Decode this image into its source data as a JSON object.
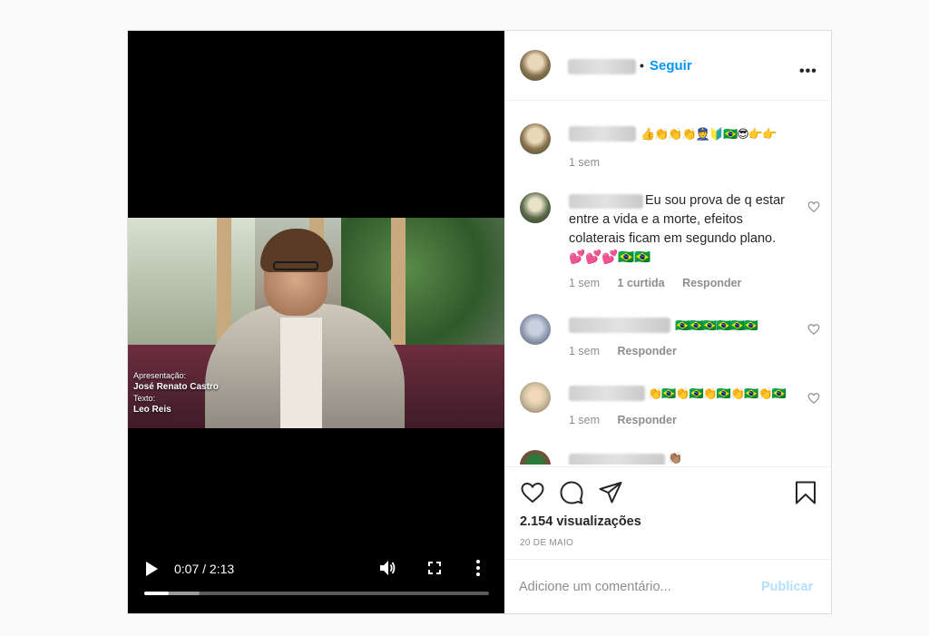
{
  "video": {
    "caption_line1": "Apresentação:",
    "caption_line2": "José Renato Castro",
    "caption_line3": "Texto:",
    "caption_line4": "Leo Reis",
    "time": "0:07 / 2:13",
    "played_fraction": 0.07,
    "buffered_fraction": 0.16,
    "play_icon": "play-icon",
    "volume_icon": "volume-icon",
    "fullscreen_icon": "fullscreen-icon",
    "more_icon": "more-vert-icon"
  },
  "header": {
    "dot": "•",
    "follow_label": "Seguir",
    "more_icon": "more-horizontal-icon"
  },
  "comments": [
    {
      "text": "👍👏👏👏👮🔰🇧🇷😎👉👉",
      "meta": [
        "1 sem"
      ]
    },
    {
      "text": "Eu sou prova de q estar entre a vida e a morte, efeitos colaterais ficam em segundo plano. 💕💕💕🇧🇷🇧🇷",
      "meta": [
        "1 sem",
        "1 curtida",
        "Responder"
      ]
    },
    {
      "text": "🇧🇷🇧🇷🇧🇷🇧🇷🇧🇷🇧🇷",
      "meta": [
        "1 sem",
        "Responder"
      ]
    },
    {
      "text": "👏🇧🇷👏🇧🇷👏🇧🇷👏🇧🇷👏🇧🇷",
      "meta": [
        "1 sem",
        "Responder"
      ]
    },
    {
      "text": "👏🏽",
      "meta": []
    }
  ],
  "actions": {
    "views": "2.154 visualizações",
    "date": "20 DE MAIO"
  },
  "add_comment": {
    "placeholder": "Adicione um comentário...",
    "publish_label": "Publicar"
  },
  "colors": {
    "follow": "#0095f6",
    "publish_disabled": "#b2dffc",
    "meta_text": "#8e8e8e"
  }
}
